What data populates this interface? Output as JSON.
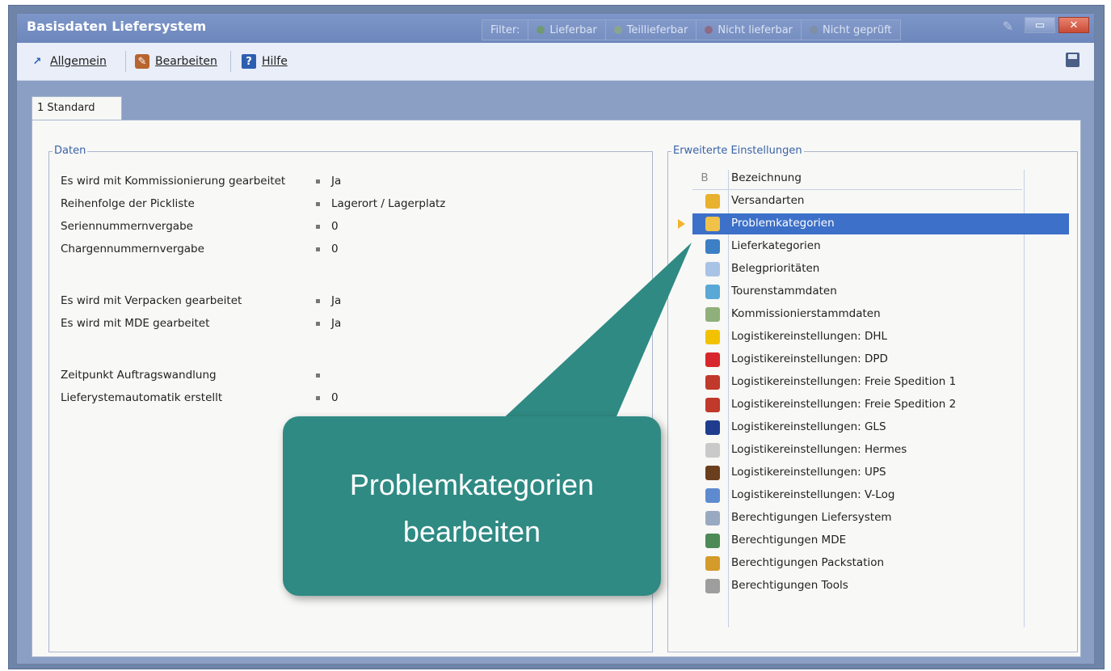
{
  "window": {
    "title": "Basisdaten Liefersystem",
    "filter": {
      "label": "Filter:",
      "options": [
        {
          "label": "Lieferbar",
          "color": "#6f9a72"
        },
        {
          "label": "Teillieferbar",
          "color": "#8aa58d"
        },
        {
          "label": "Nicht lieferbar",
          "color": "#8e6b84"
        },
        {
          "label": "Nicht geprüft",
          "color": "#7e8fa6"
        }
      ]
    }
  },
  "toolbar": {
    "allgemein": "Allgemein",
    "bearbeiten": "Bearbeiten",
    "hilfe": "Hilfe"
  },
  "tabs": [
    {
      "label": "1 Standard"
    }
  ],
  "daten": {
    "title": "Daten",
    "rows": [
      {
        "label": "Es wird mit Kommissionierung gearbeitet",
        "value": "Ja"
      },
      {
        "label": "Reihenfolge der Pickliste",
        "value": "Lagerort / Lagerplatz"
      },
      {
        "label": "Seriennummernvergabe",
        "value": "0"
      },
      {
        "label": "Chargennummernvergabe",
        "value": "0"
      },
      {
        "label": "Es wird mit Verpacken gearbeitet",
        "value": "Ja"
      },
      {
        "label": "Es wird mit MDE gearbeitet",
        "value": "Ja"
      },
      {
        "label": "Zeitpunkt Auftragswandlung",
        "value": ""
      },
      {
        "label": "Lieferystemautomatik erstellt",
        "value": "0"
      }
    ]
  },
  "erweitert": {
    "title": "Erweiterte Einstellungen",
    "header_col_b": "B",
    "header_col_name": "Bezeichnung",
    "items": [
      {
        "label": "Versandarten",
        "icon": "box-icon",
        "color": "#e8b12e"
      },
      {
        "label": "Problemkategorien",
        "icon": "warning-icon",
        "color": "#f0c24a",
        "selected": true
      },
      {
        "label": "Lieferkategorien",
        "icon": "truck-icon",
        "color": "#3d7fc4"
      },
      {
        "label": "Belegprioritäten",
        "icon": "document-icon",
        "color": "#a9c3e6"
      },
      {
        "label": "Tourenstammdaten",
        "icon": "route-arrows-icon",
        "color": "#5aa8d6"
      },
      {
        "label": "Kommissionierstammdaten",
        "icon": "picking-icon",
        "color": "#8fb07a"
      },
      {
        "label": "Logistikereinstellungen: DHL",
        "icon": "dhl-icon",
        "color": "#f2c200"
      },
      {
        "label": "Logistikereinstellungen: DPD",
        "icon": "dpd-icon",
        "color": "#d7262d"
      },
      {
        "label": "Logistikereinstellungen: Freie Spedition 1",
        "icon": "lorry-icon",
        "color": "#c0392b"
      },
      {
        "label": "Logistikereinstellungen: Freie Spedition 2",
        "icon": "lorry-icon",
        "color": "#c0392b"
      },
      {
        "label": "Logistikereinstellungen: GLS",
        "icon": "gls-icon",
        "color": "#1f3c8f"
      },
      {
        "label": "Logistikereinstellungen: Hermes",
        "icon": "hermes-icon",
        "color": "#c9c9c9"
      },
      {
        "label": "Logistikereinstellungen: UPS",
        "icon": "ups-icon",
        "color": "#6b3f1d"
      },
      {
        "label": "Logistikereinstellungen: V-Log",
        "icon": "vlog-icon",
        "color": "#5e8bd0"
      },
      {
        "label": "Berechtigungen Liefersystem",
        "icon": "list-icon",
        "color": "#9aa9c2"
      },
      {
        "label": "Berechtigungen MDE",
        "icon": "handheld-icon",
        "color": "#4e8a55"
      },
      {
        "label": "Berechtigungen Packstation",
        "icon": "packstation-icon",
        "color": "#d49b2a"
      },
      {
        "label": "Berechtigungen Tools",
        "icon": "tools-icon",
        "color": "#9e9e9e"
      }
    ]
  },
  "callout": {
    "line1": "Problemkategorien",
    "line2": "bearbeiten",
    "color": "#2f8a83"
  }
}
